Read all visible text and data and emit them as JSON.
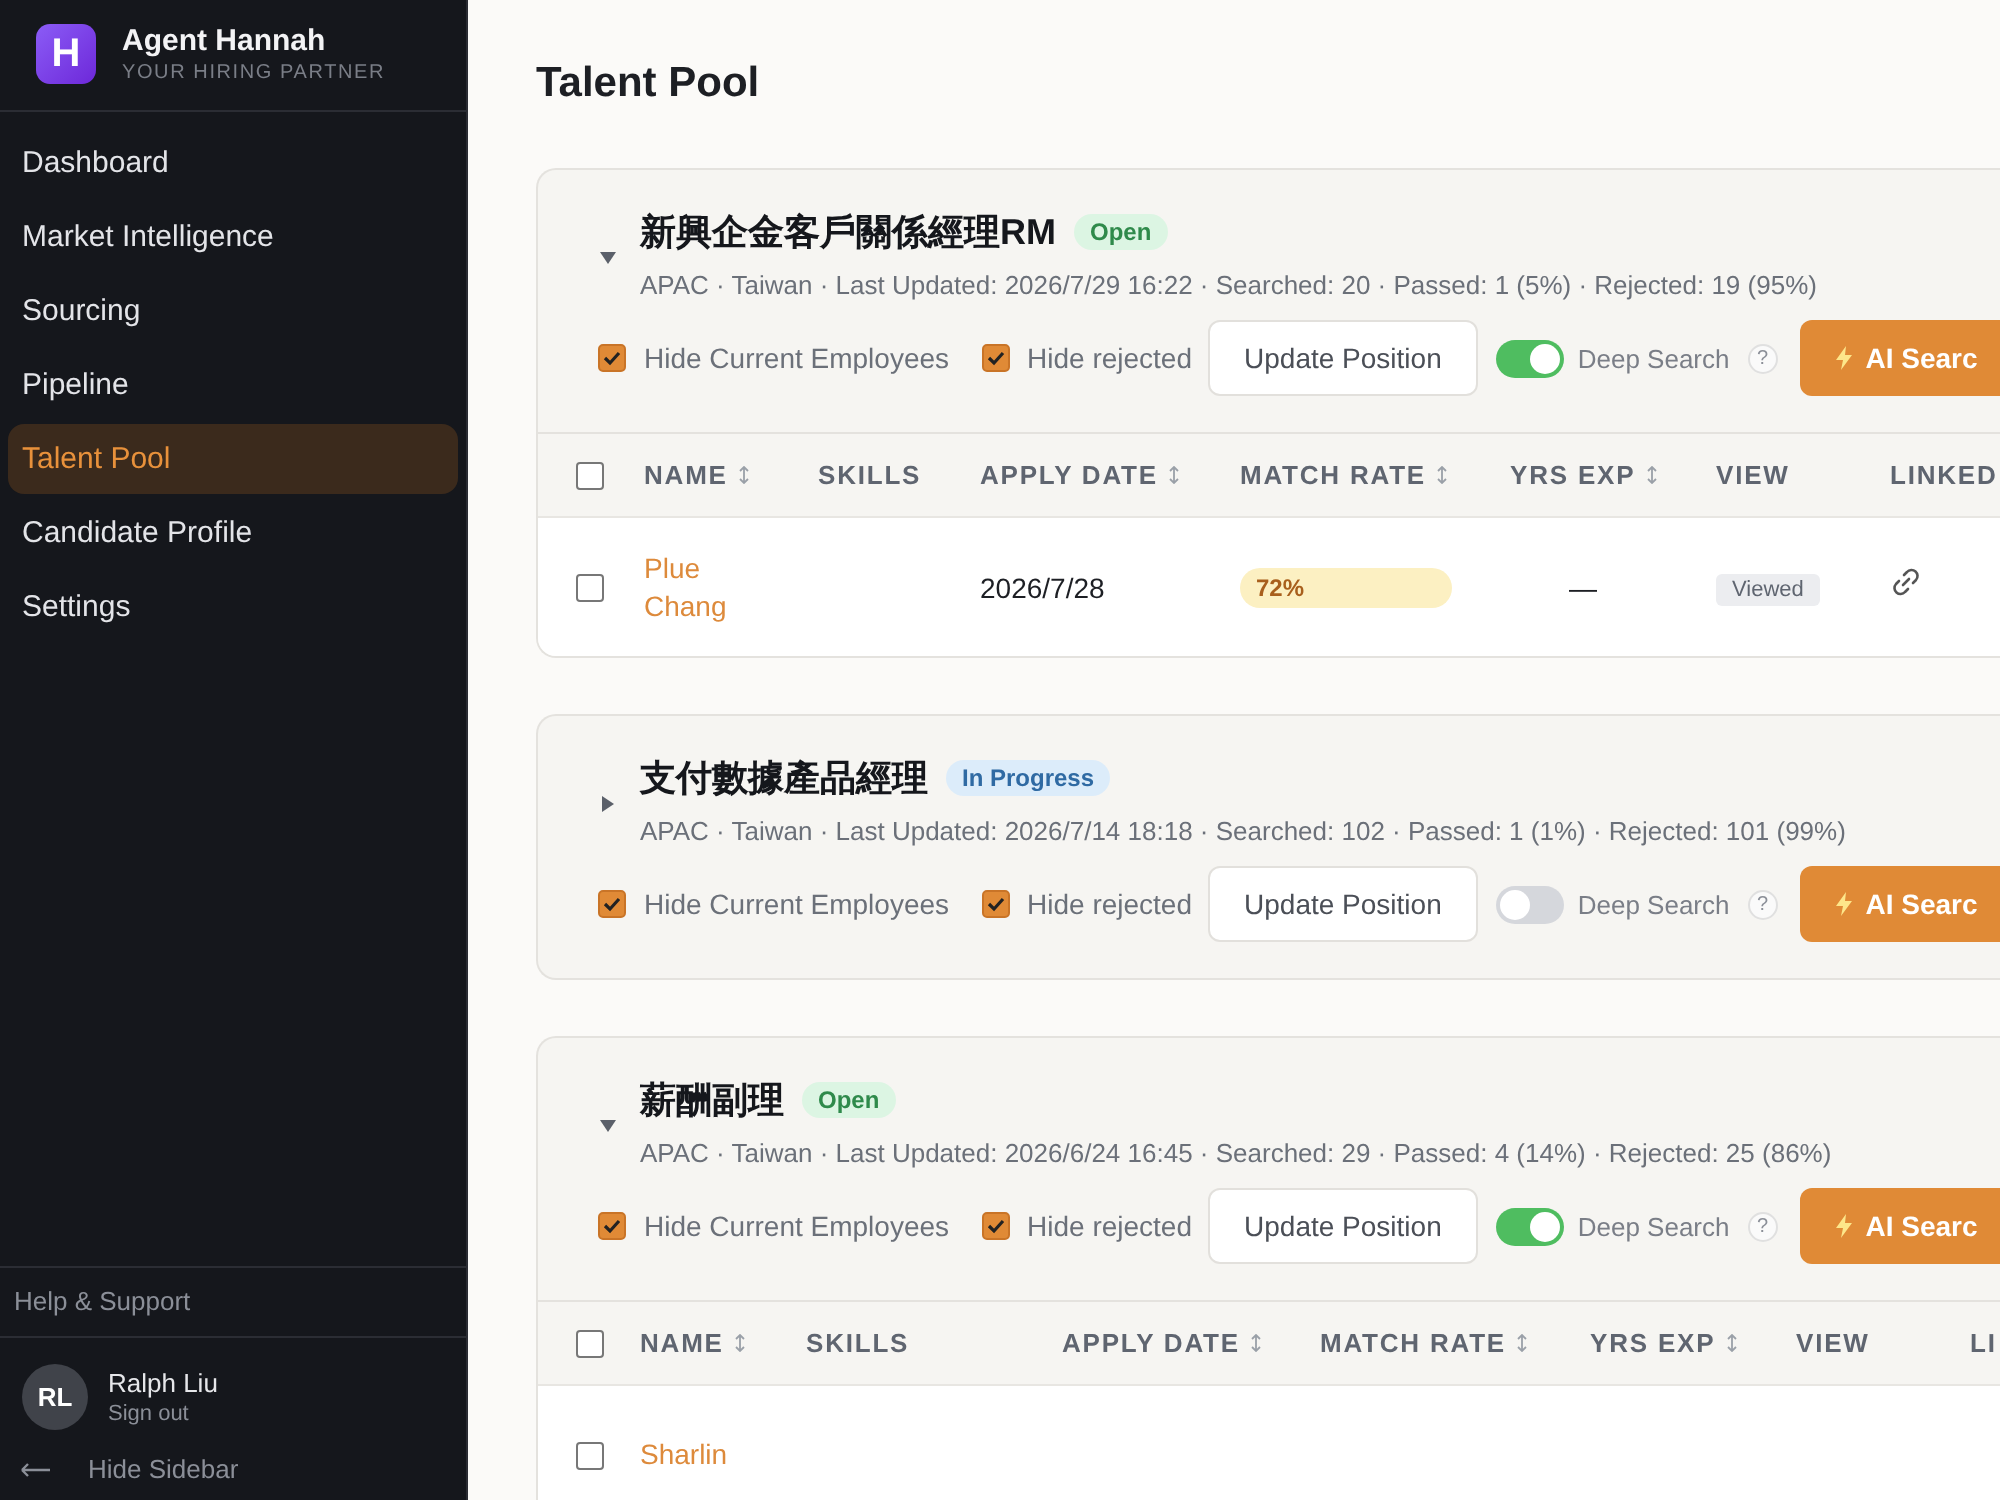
{
  "brand": {
    "logo": "H",
    "name": "Agent Hannah",
    "tagline": "YOUR HIRING PARTNER"
  },
  "nav": [
    {
      "label": "Dashboard",
      "selected": false
    },
    {
      "label": "Market Intelligence",
      "selected": false
    },
    {
      "label": "Sourcing",
      "selected": false
    },
    {
      "label": "Pipeline",
      "selected": false
    },
    {
      "label": "Talent Pool",
      "selected": true
    },
    {
      "label": "Candidate Profile",
      "selected": false
    },
    {
      "label": "Settings",
      "selected": false
    }
  ],
  "help": "Help & Support",
  "user": {
    "initials": "RL",
    "name": "Ralph Liu",
    "action": "Sign out"
  },
  "hide_sidebar": "Hide Sidebar",
  "page_title": "Talent Pool",
  "positions": [
    {
      "title": "新興企金客戶關係經理RM",
      "status": {
        "label": "Open",
        "kind": "open"
      },
      "expanded": true,
      "meta": "APAC · Taiwan · Last Updated: 2026/7/29 16:22 · Searched: 20 · Passed: 1 (5%) · Rejected: 19 (95%)",
      "hide_current": {
        "label": "Hide Current Employees",
        "checked": true
      },
      "hide_rejected": {
        "label": "Hide rejected",
        "checked": true
      },
      "update_button": "Update Position",
      "deep_search": {
        "label": "Deep Search",
        "on": true,
        "help": "?"
      },
      "ai_button": "AI Searc",
      "columns": [
        {
          "label": "NAME",
          "sortable": true
        },
        {
          "label": "SKILLS",
          "sortable": false
        },
        {
          "label": "APPLY DATE",
          "sortable": true
        },
        {
          "label": "MATCH RATE",
          "sortable": true
        },
        {
          "label": "YRS EXP",
          "sortable": true
        },
        {
          "label": "VIEW",
          "sortable": false
        },
        {
          "label": "LINKED",
          "sortable": false
        }
      ],
      "select_all_checked": false,
      "rows": [
        {
          "name": "Plue Chang",
          "checked": false,
          "apply_date": "2026/7/28",
          "match_rate": "72%",
          "yrs_exp": "—",
          "view": "Viewed"
        }
      ]
    },
    {
      "title": "支付數據產品經理",
      "status": {
        "label": "In Progress",
        "kind": "progress"
      },
      "expanded": false,
      "meta": "APAC · Taiwan · Last Updated: 2026/7/14 18:18 · Searched: 102 · Passed: 1 (1%) · Rejected: 101 (99%)",
      "hide_current": {
        "label": "Hide Current Employees",
        "checked": true
      },
      "hide_rejected": {
        "label": "Hide rejected",
        "checked": true
      },
      "update_button": "Update Position",
      "deep_search": {
        "label": "Deep Search",
        "on": false,
        "help": "?"
      },
      "ai_button": "AI Searc"
    },
    {
      "title": "薪酬副理",
      "status": {
        "label": "Open",
        "kind": "open"
      },
      "expanded": true,
      "meta": "APAC · Taiwan · Last Updated: 2026/6/24 16:45 · Searched: 29 · Passed: 4 (14%) · Rejected: 25 (86%)",
      "hide_current": {
        "label": "Hide Current Employees",
        "checked": true
      },
      "hide_rejected": {
        "label": "Hide rejected",
        "checked": true
      },
      "update_button": "Update Position",
      "deep_search": {
        "label": "Deep Search",
        "on": true,
        "help": "?"
      },
      "ai_button": "AI Searc",
      "columns": [
        {
          "label": "NAME",
          "sortable": true
        },
        {
          "label": "SKILLS",
          "sortable": false
        },
        {
          "label": "APPLY DATE",
          "sortable": true
        },
        {
          "label": "MATCH RATE",
          "sortable": true
        },
        {
          "label": "YRS EXP",
          "sortable": true
        },
        {
          "label": "VIEW",
          "sortable": false
        },
        {
          "label": "LI",
          "sortable": false
        }
      ],
      "select_all_checked": false,
      "rows": [
        {
          "name": "Sharlin",
          "checked": false
        }
      ]
    }
  ]
}
